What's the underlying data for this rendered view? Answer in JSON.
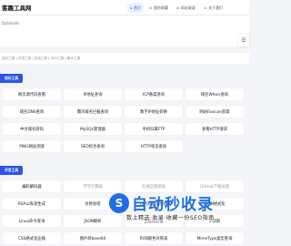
{
  "header": {
    "logo": "客趣工具网",
    "nav": [
      {
        "icon": "⌂",
        "label": "首页",
        "active": true
      },
      {
        "icon": "⊙",
        "label": "我的收藏",
        "active": false
      },
      {
        "icon": "◎",
        "label": "网站收录",
        "active": false
      },
      {
        "icon": "▭",
        "label": "关于我们",
        "active": false
      }
    ]
  },
  "search": {
    "placeholder": "Datatools"
  },
  "links": "站长工具 | 开发工具 | 在线工具 | SEO工具 | 娱乐工具",
  "sections": [
    {
      "title": "站长工具",
      "tools": [
        [
          "网页源代码查看",
          "IP地址查询",
          "ICP备案查询",
          "域名Whois查询"
        ],
        [
          "域名DNS查询",
          "腾讯域名拦截查询",
          "数字IP地址转换",
          "网站Favicon获取"
        ],
        [
          "中文域名转码",
          "MySQL管理器",
          "手机归属FTP",
          "查看HTTP请求"
        ],
        [
          "PING网站测速",
          "SEO综合查询",
          "HTTP状态查询",
          ""
        ]
      ]
    },
    {
      "title": "开发工具",
      "tools": [
        [
          "编码解码器",
          "字节计算器",
          "在线正则测试",
          "GitHub下载加速"
        ],
        [
          "RSA公私钥生成",
          "对称加密",
          "JS代码混淆加密",
          "JSON格式化"
        ],
        [
          "Linux命令查询",
          "JSON解析",
          "生成校验值",
          "IP获取"
        ],
        [
          "CSS格式化压缩",
          "图片转base64",
          "ROB颜色对照表",
          "MimeType类型查询"
        ]
      ]
    }
  ],
  "watermark": {
    "icon": "S",
    "title": "自动秒收录",
    "subtitle": "数上精选·收录·收藏一份SEO指南"
  },
  "side_icon": "☰"
}
